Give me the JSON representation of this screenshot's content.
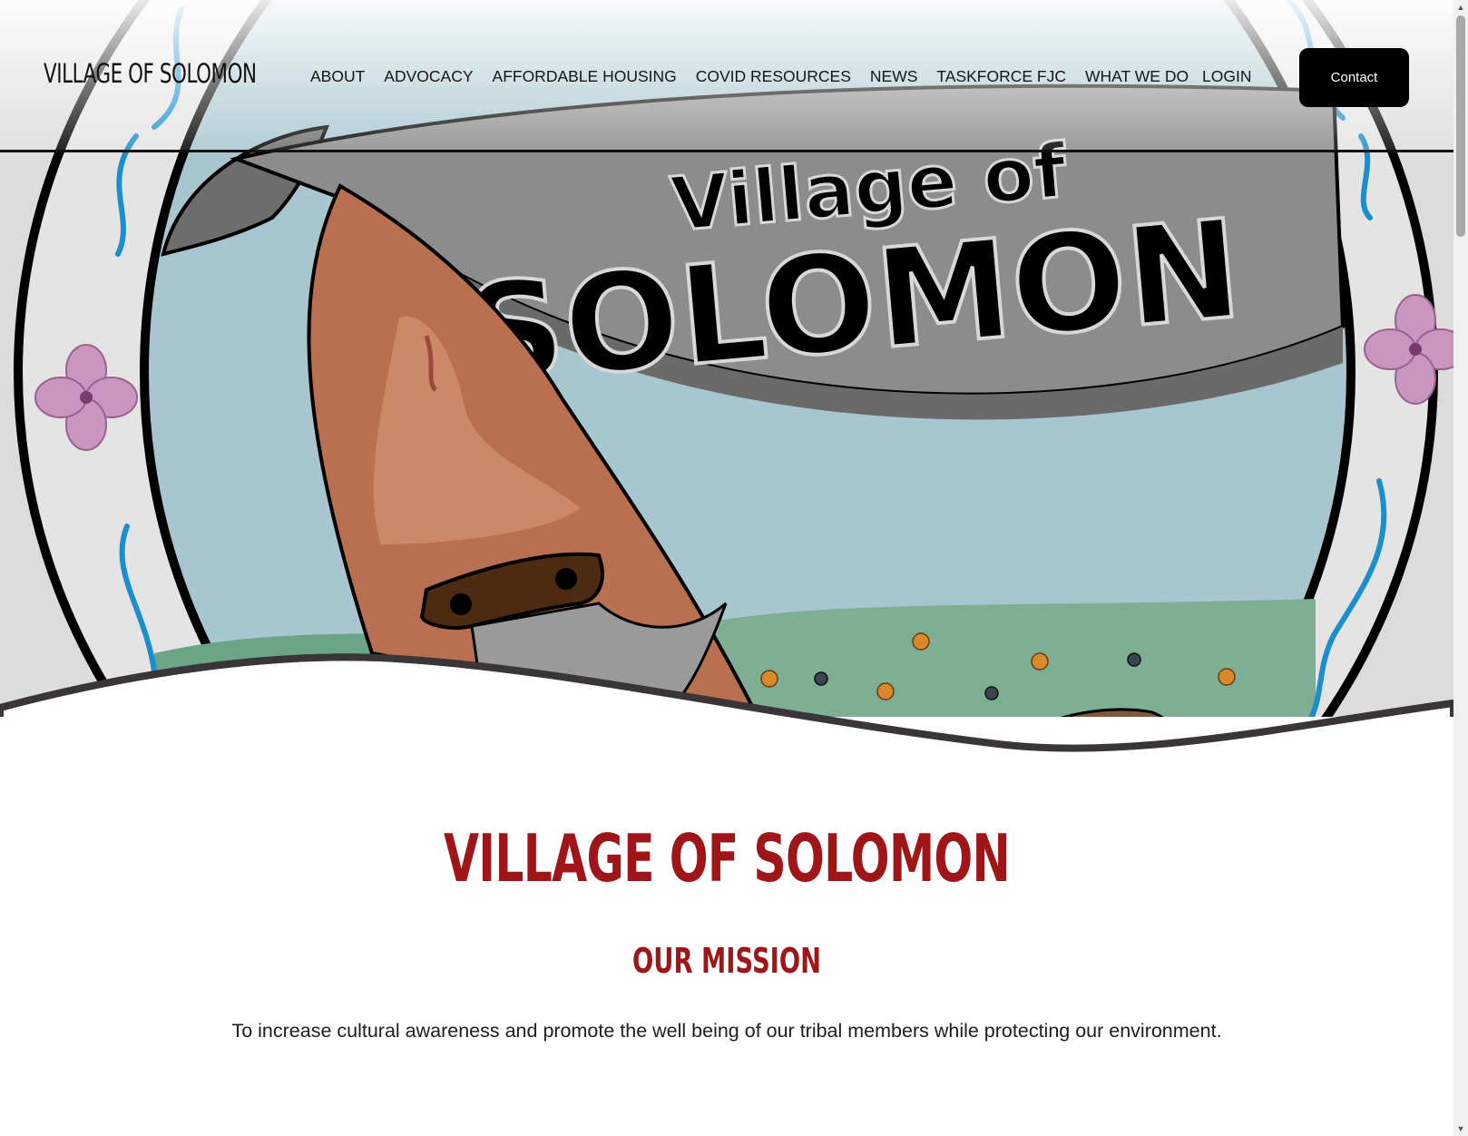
{
  "header": {
    "site_title": "VILLAGE OF SOLOMON",
    "nav": [
      {
        "label": "ABOUT"
      },
      {
        "label": "ADVOCACY"
      },
      {
        "label": "AFFORDABLE HOUSING"
      },
      {
        "label": "COVID RESOURCES"
      },
      {
        "label": "NEWS"
      },
      {
        "label": "TASKFORCE FJC"
      },
      {
        "label": "WHAT WE DO"
      }
    ],
    "login_label": "LOGIN",
    "contact_label": "Contact"
  },
  "hero": {
    "banner_line1": "Village of",
    "banner_line2": "SOLOMON"
  },
  "main": {
    "heading": "VILLAGE OF SOLOMON",
    "subheading": "OUR MISSION",
    "mission": "To increase cultural awareness and promote the well being of our tribal members while protecting our environment."
  },
  "colors": {
    "accent_red": "#a01518",
    "header_border": "#111111",
    "contact_bg": "#000000",
    "sky": "#a7c6cf",
    "banner_gray": "#8c8c8c",
    "flower_pink": "#c996c0",
    "river_blue": "#1a8ecf"
  },
  "icons": {
    "scroll_up": "scroll-up-arrow-icon",
    "scroll_down": "scroll-down-arrow-icon"
  }
}
